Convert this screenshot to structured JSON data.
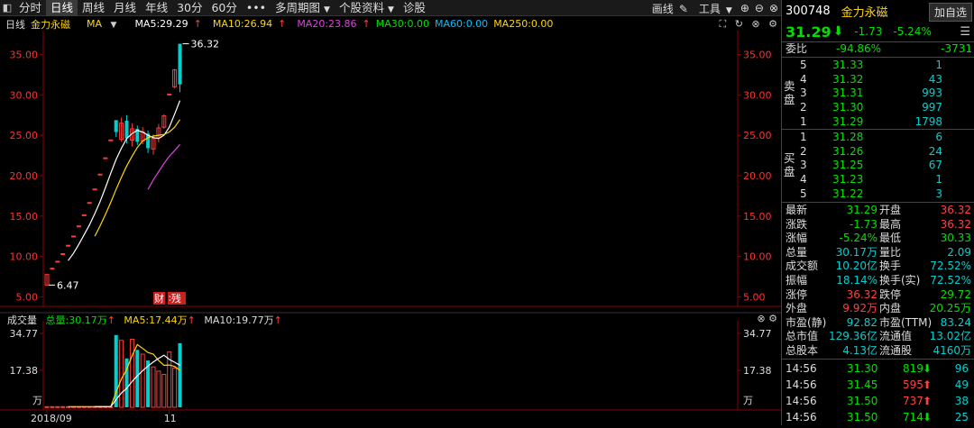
{
  "toolbar": {
    "items": [
      "分时",
      "日线",
      "周线",
      "月线",
      "年线",
      "30分",
      "60分",
      "多周期图",
      "个股资料",
      "诊股"
    ],
    "active_index": 1,
    "right_items": [
      "画线",
      "工具"
    ]
  },
  "legend": {
    "period": "日线",
    "name": "金力永磁",
    "ma_label": "MA",
    "ma5": "MA5:29.29",
    "ma10": "MA10:26.94",
    "ma20": "MA20:23.86",
    "ma30": "MA30:0.00",
    "ma60": "MA60:0.00",
    "ma250": "MA250:0.00"
  },
  "volume_legend": {
    "label": "成交量",
    "total": "总量:30.17万",
    "ma5": "MA5:17.44万",
    "ma10": "MA10:19.77万"
  },
  "chart_data": [
    {
      "type": "candlestick",
      "y_ticks": [
        "35.00",
        "30.00",
        "25.00",
        "20.00",
        "15.00",
        "10.00",
        "5.00"
      ],
      "ylim": [
        4.5,
        37.5
      ],
      "annotations": {
        "high_label": "36.32",
        "low_label": "6.47",
        "badge_fin": "财",
        "badge_sell": "∶残"
      },
      "candles": [
        {
          "o": 6.47,
          "c": 7.77,
          "h": 7.77,
          "l": 6.47
        },
        {
          "o": 8.55,
          "c": 8.55,
          "h": 8.55,
          "l": 8.55
        },
        {
          "o": 9.41,
          "c": 9.41,
          "h": 9.41,
          "l": 9.41
        },
        {
          "o": 10.35,
          "c": 10.35,
          "h": 10.35,
          "l": 10.35
        },
        {
          "o": 11.39,
          "c": 11.39,
          "h": 11.39,
          "l": 11.39
        },
        {
          "o": 12.53,
          "c": 12.53,
          "h": 12.53,
          "l": 12.53
        },
        {
          "o": 13.78,
          "c": 13.78,
          "h": 13.78,
          "l": 13.78
        },
        {
          "o": 15.16,
          "c": 15.16,
          "h": 15.16,
          "l": 15.16
        },
        {
          "o": 16.68,
          "c": 16.68,
          "h": 16.68,
          "l": 16.68
        },
        {
          "o": 18.35,
          "c": 18.35,
          "h": 18.35,
          "l": 18.35
        },
        {
          "o": 20.19,
          "c": 20.19,
          "h": 20.19,
          "l": 20.19
        },
        {
          "o": 22.21,
          "c": 22.21,
          "h": 22.21,
          "l": 22.21
        },
        {
          "o": 24.43,
          "c": 24.43,
          "h": 24.43,
          "l": 24.43
        },
        {
          "o": 26.87,
          "c": 25.4,
          "h": 26.87,
          "l": 24.8
        },
        {
          "o": 24.5,
          "c": 26.5,
          "h": 27.2,
          "l": 24.2
        },
        {
          "o": 26.8,
          "c": 24.6,
          "h": 27.5,
          "l": 24.0
        },
        {
          "o": 24.4,
          "c": 25.8,
          "h": 26.5,
          "l": 23.6
        },
        {
          "o": 25.8,
          "c": 24.2,
          "h": 26.2,
          "l": 23.8
        },
        {
          "o": 24.3,
          "c": 25.4,
          "h": 26.0,
          "l": 23.9
        },
        {
          "o": 25.2,
          "c": 23.4,
          "h": 25.6,
          "l": 22.8
        },
        {
          "o": 23.3,
          "c": 24.6,
          "h": 25.1,
          "l": 22.6
        },
        {
          "o": 24.7,
          "c": 25.9,
          "h": 26.4,
          "l": 24.1
        },
        {
          "o": 26.0,
          "c": 27.4,
          "h": 27.6,
          "l": 25.8
        },
        {
          "o": 30.1,
          "c": 30.1,
          "h": 30.1,
          "l": 30.1
        },
        {
          "o": 31.0,
          "c": 33.1,
          "h": 33.2,
          "l": 30.8
        },
        {
          "o": 36.32,
          "c": 31.29,
          "h": 36.32,
          "l": 30.33
        }
      ],
      "ma5": [
        null,
        null,
        null,
        null,
        9.5,
        10.4,
        11.5,
        12.7,
        13.9,
        15.3,
        16.8,
        18.5,
        20.3,
        22.0,
        23.4,
        24.6,
        25.2,
        25.6,
        25.4,
        25.0,
        24.7,
        24.6,
        25.0,
        26.0,
        27.6,
        29.29
      ],
      "ma10": [
        null,
        null,
        null,
        null,
        null,
        null,
        null,
        null,
        null,
        12.5,
        13.8,
        15.2,
        16.7,
        18.3,
        19.8,
        21.2,
        22.4,
        23.5,
        24.3,
        24.7,
        24.9,
        25.0,
        25.1,
        25.4,
        26.0,
        26.94
      ],
      "ma20": [
        null,
        null,
        null,
        null,
        null,
        null,
        null,
        null,
        null,
        null,
        null,
        null,
        null,
        null,
        null,
        null,
        null,
        null,
        null,
        18.3,
        19.5,
        20.5,
        21.5,
        22.4,
        23.1,
        23.86
      ]
    },
    {
      "type": "bar",
      "title": "成交量",
      "y_ticks": [
        "34.77",
        "17.38",
        "万"
      ],
      "x_ticks": [
        "2018/09",
        "11"
      ],
      "ylim": [
        0,
        34.77
      ],
      "values": [
        0.3,
        0.3,
        0.3,
        0.3,
        0.3,
        0.3,
        0.3,
        0.3,
        0.3,
        0.3,
        0.3,
        0.3,
        0.3,
        34.0,
        31.5,
        23.0,
        32.0,
        27.0,
        25.0,
        22.0,
        19.0,
        17.0,
        15.5,
        26.0,
        18.5,
        30.17
      ],
      "ma5": [
        null,
        null,
        null,
        null,
        0.3,
        0.3,
        0.3,
        0.3,
        0.3,
        0.3,
        0.3,
        0.3,
        0.3,
        7.1,
        13.3,
        17.8,
        24.2,
        29.5,
        27.7,
        25.8,
        25.0,
        22.0,
        19.7,
        19.9,
        19.2,
        17.44
      ],
      "ma10": [
        null,
        null,
        null,
        null,
        null,
        null,
        null,
        null,
        null,
        0.3,
        0.3,
        0.3,
        0.3,
        3.6,
        6.7,
        8.9,
        12.1,
        14.8,
        17.2,
        19.4,
        21.3,
        23.0,
        24.5,
        22.5,
        21.2,
        19.77
      ]
    }
  ],
  "panel": {
    "code": "300748",
    "name": "金力永磁",
    "add_label": "加自选",
    "price": "31.29",
    "change": "-1.73",
    "change_pct": "-5.24%",
    "weibi_label": "委比",
    "weibi_pct": "-94.86%",
    "weibi_diff": "-3731",
    "sell_label": "卖盘",
    "buy_label": "买盘",
    "sell": [
      {
        "lvl": "5",
        "price": "31.33",
        "vol": "1"
      },
      {
        "lvl": "4",
        "price": "31.32",
        "vol": "43"
      },
      {
        "lvl": "3",
        "price": "31.31",
        "vol": "993"
      },
      {
        "lvl": "2",
        "price": "31.30",
        "vol": "997"
      },
      {
        "lvl": "1",
        "price": "31.29",
        "vol": "1798"
      }
    ],
    "buy": [
      {
        "lvl": "1",
        "price": "31.28",
        "vol": "6"
      },
      {
        "lvl": "2",
        "price": "31.26",
        "vol": "24"
      },
      {
        "lvl": "3",
        "price": "31.25",
        "vol": "67"
      },
      {
        "lvl": "4",
        "price": "31.23",
        "vol": "1"
      },
      {
        "lvl": "5",
        "price": "31.22",
        "vol": "3"
      }
    ],
    "quote": [
      {
        "l1": "最新",
        "v1": "31.29",
        "c1": "g",
        "l2": "开盘",
        "v2": "36.32",
        "c2": "r"
      },
      {
        "l1": "涨跌",
        "v1": "-1.73",
        "c1": "g",
        "l2": "最高",
        "v2": "36.32",
        "c2": "r"
      },
      {
        "l1": "涨幅",
        "v1": "-5.24%",
        "c1": "g",
        "l2": "最低",
        "v2": "30.33",
        "c2": "g"
      },
      {
        "l1": "总量",
        "v1": "30.17万",
        "c1": "c",
        "l2": "量比",
        "v2": "2.09",
        "c2": "c"
      },
      {
        "l1": "成交额",
        "v1": "10.20亿",
        "c1": "c",
        "l2": "换手",
        "v2": "72.52%",
        "c2": "c"
      },
      {
        "l1": "振幅",
        "v1": "18.14%",
        "c1": "c",
        "l2": "换手(实)",
        "v2": "72.52%",
        "c2": "c"
      },
      {
        "l1": "涨停",
        "v1": "36.32",
        "c1": "r",
        "l2": "跌停",
        "v2": "29.72",
        "c2": "g"
      },
      {
        "l1": "外盘",
        "v1": "9.92万",
        "c1": "r",
        "l2": "内盘",
        "v2": "20.25万",
        "c2": "g"
      },
      {
        "l1": "市盈(静)",
        "v1": "92.82",
        "c1": "c",
        "l2": "市盈(TTM)",
        "v2": "83.24",
        "c2": "c"
      },
      {
        "l1": "总市值",
        "v1": "129.36亿",
        "c1": "c",
        "l2": "流通值",
        "v2": "13.02亿",
        "c2": "c"
      },
      {
        "l1": "总股本",
        "v1": "4.13亿",
        "c1": "c",
        "l2": "流通股",
        "v2": "4160万",
        "c2": "c"
      }
    ],
    "ticks": [
      {
        "time": "14:56",
        "price": "31.30",
        "vol": "819",
        "dir": "down",
        "num": "96"
      },
      {
        "time": "14:56",
        "price": "31.45",
        "vol": "595",
        "dir": "up",
        "num": "49"
      },
      {
        "time": "14:56",
        "price": "31.50",
        "vol": "737",
        "dir": "up",
        "num": "38"
      },
      {
        "time": "14:56",
        "price": "31.50",
        "vol": "714",
        "dir": "down",
        "num": "25"
      }
    ]
  },
  "colors": {
    "up": "#ff3b3b",
    "down": "#00d0d0",
    "ma5": "#ffffff",
    "ma10": "#ffd700",
    "ma20": "#e040e0",
    "ma30": "#00e000",
    "ma60": "#00c0ff"
  }
}
